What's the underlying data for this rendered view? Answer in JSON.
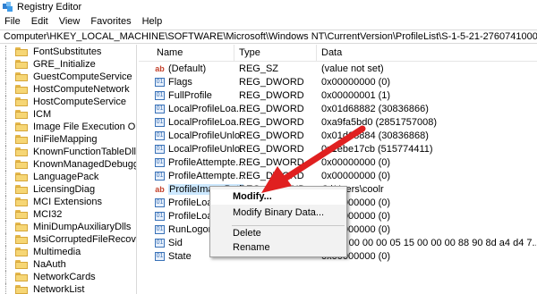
{
  "window": {
    "title": "Registry Editor"
  },
  "menu": [
    "File",
    "Edit",
    "View",
    "Favorites",
    "Help"
  ],
  "address": "Computer\\HKEY_LOCAL_MACHINE\\SOFTWARE\\Microsoft\\Windows NT\\CurrentVersion\\ProfileList\\S-1-5-21-2760741000-532640212-2206957592-10",
  "tree": [
    "FontSubstitutes",
    "GRE_Initialize",
    "GuestComputeService",
    "HostComputeNetwork",
    "HostComputeService",
    "ICM",
    "Image File Execution Option",
    "IniFileMapping",
    "KnownFunctionTableDlls",
    "KnownManagedDebuggingI",
    "LanguagePack",
    "LicensingDiag",
    "MCI Extensions",
    "MCI32",
    "MiniDumpAuxiliaryDlls",
    "MsiCorruptedFileRecovery",
    "Multimedia",
    "NaAuth",
    "NetworkCards",
    "NetworkList"
  ],
  "columns": {
    "name": "Name",
    "type": "Type",
    "data": "Data"
  },
  "values": [
    {
      "icon": "ab",
      "name": "(Default)",
      "type": "REG_SZ",
      "data": "(value not set)"
    },
    {
      "icon": "bin",
      "name": "Flags",
      "type": "REG_DWORD",
      "data": "0x00000000 (0)"
    },
    {
      "icon": "bin",
      "name": "FullProfile",
      "type": "REG_DWORD",
      "data": "0x00000001 (1)"
    },
    {
      "icon": "bin",
      "name": "LocalProfileLoa...",
      "type": "REG_DWORD",
      "data": "0x01d68882 (30836866)"
    },
    {
      "icon": "bin",
      "name": "LocalProfileLoa...",
      "type": "REG_DWORD",
      "data": "0xa9fa5bd0 (2851757008)"
    },
    {
      "icon": "bin",
      "name": "LocalProfileUnlo...",
      "type": "REG_DWORD",
      "data": "0x01d68884 (30836868)"
    },
    {
      "icon": "bin",
      "name": "LocalProfileUnlo...",
      "type": "REG_DWORD",
      "data": "0x1ebe17cb (515774411)"
    },
    {
      "icon": "bin",
      "name": "ProfileAttempte...",
      "type": "REG_DWORD",
      "data": "0x00000000 (0)"
    },
    {
      "icon": "bin",
      "name": "ProfileAttempte...",
      "type": "REG_DWORD",
      "data": "0x00000000 (0)"
    },
    {
      "icon": "ab",
      "name": "ProfileImagePath",
      "type": "REG_EXPAND_SZ",
      "data": "C:\\Users\\coolr",
      "selected": true
    },
    {
      "icon": "bin",
      "name": "ProfileLoa...",
      "type": "",
      "data": "0x00000000 (0)"
    },
    {
      "icon": "bin",
      "name": "ProfileLoa...",
      "type": "",
      "data": "0x00000000 (0)"
    },
    {
      "icon": "bin",
      "name": "RunLogonS...",
      "type": "",
      "data": "0x00000000 (0)"
    },
    {
      "icon": "bin",
      "name": "Sid",
      "type": "",
      "data": "00 00 00 00 00 05 15 00 00 00 88 90 8d a4 d4 7..."
    },
    {
      "icon": "bin",
      "name": "State",
      "type": "",
      "data": "0x00000000 (0)"
    }
  ],
  "context_menu": {
    "modify": "Modify...",
    "modify_binary": "Modify Binary Data...",
    "delete": "Delete",
    "rename": "Rename"
  },
  "colors": {
    "selection": "#cce8ff",
    "arrow": "#e02020",
    "folder": "#f6d675"
  },
  "icons": {
    "app": "registry-editor-icon",
    "folder": "folder-icon",
    "string_value": "ab-string-icon",
    "binary_value": "binary-value-icon",
    "annotation": "red-arrow-annotation"
  }
}
